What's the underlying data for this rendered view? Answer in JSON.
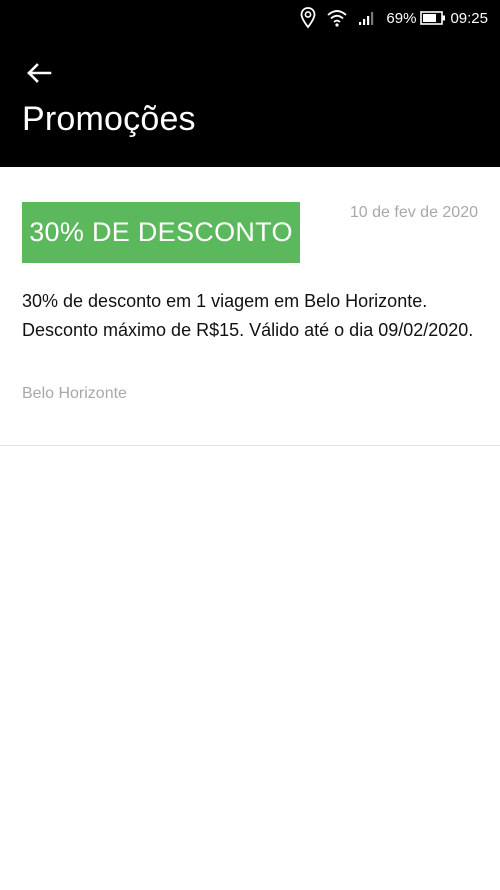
{
  "status_bar": {
    "battery_percent": "69%",
    "time": "09:25",
    "icons": [
      "location-icon",
      "wifi-icon",
      "signal-icon",
      "battery-icon"
    ]
  },
  "header": {
    "back_icon": "arrow-left-icon",
    "title": "Promoções"
  },
  "promo": {
    "badge": "30% DE DESCONTO",
    "date": "10 de fev de 2020",
    "description": "30% de desconto em 1 viagem em Belo Horizonte. Desconto máximo de R$15. Válido até o dia 09/02/2020.",
    "city": "Belo Horizonte"
  },
  "colors": {
    "header_background": "#000000",
    "badge_green": "#5cb85c",
    "muted_text": "#a8a8a8"
  }
}
